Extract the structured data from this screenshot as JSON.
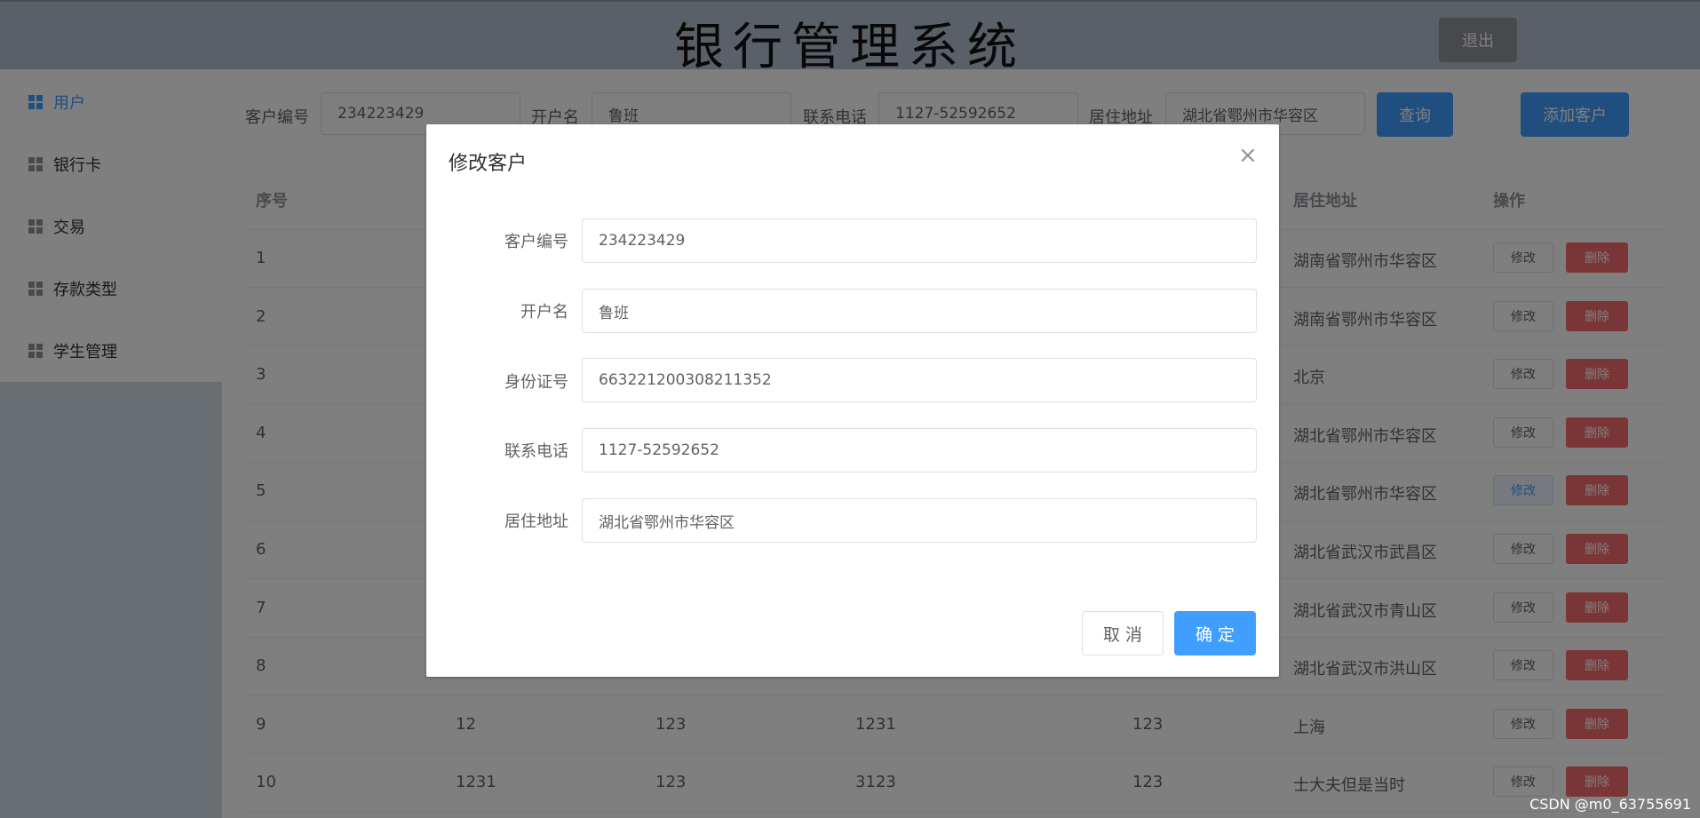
{
  "header": {
    "title": "银行管理系统",
    "logout_label": "退出"
  },
  "sidebar": {
    "items": [
      {
        "label": "用户"
      },
      {
        "label": "银行卡"
      },
      {
        "label": "交易"
      },
      {
        "label": "存款类型"
      },
      {
        "label": "学生管理"
      }
    ]
  },
  "search": {
    "customer_id_label": "客户编号",
    "customer_id_value": "234223429",
    "name_label": "开户名",
    "name_value": "鲁班",
    "phone_label": "联系电话",
    "phone_value": "1127-52592652",
    "address_label": "居住地址",
    "address_value": "湖北省鄂州市华容区",
    "query_label": "查询",
    "add_label": "添加客户"
  },
  "table": {
    "headers": {
      "index": "序号",
      "address": "居住地址",
      "actions": "操作"
    },
    "edit_label": "修改",
    "delete_label": "删除",
    "rows": [
      {
        "index": "1",
        "c2": "",
        "c3": "",
        "c4": "",
        "c5": "",
        "address": "湖南省鄂州市华容区"
      },
      {
        "index": "2",
        "c2": "",
        "c3": "",
        "c4": "",
        "c5": "",
        "address": "湖南省鄂州市华容区"
      },
      {
        "index": "3",
        "c2": "",
        "c3": "",
        "c4": "",
        "c5": "",
        "address": "北京"
      },
      {
        "index": "4",
        "c2": "",
        "c3": "",
        "c4": "",
        "c5": "",
        "address": "湖北省鄂州市华容区"
      },
      {
        "index": "5",
        "c2": "",
        "c3": "",
        "c4": "",
        "c5": "",
        "address": "湖北省鄂州市华容区"
      },
      {
        "index": "6",
        "c2": "",
        "c3": "",
        "c4": "",
        "c5": "",
        "address": "湖北省武汉市武昌区"
      },
      {
        "index": "7",
        "c2": "",
        "c3": "",
        "c4": "",
        "c5": "",
        "address": "湖北省武汉市青山区"
      },
      {
        "index": "8",
        "c2": "",
        "c3": "",
        "c4": "",
        "c5": "",
        "address": "湖北省武汉市洪山区"
      },
      {
        "index": "9",
        "c2": "12",
        "c3": "123",
        "c4": "1231",
        "c5": "123",
        "address": "上海"
      },
      {
        "index": "10",
        "c2": "1231",
        "c3": "123",
        "c4": "3123",
        "c5": "123",
        "address": "士大夫但是当时"
      }
    ]
  },
  "dialog": {
    "title": "修改客户",
    "close_icon": "close-icon",
    "fields": [
      {
        "label": "客户编号",
        "value": "234223429"
      },
      {
        "label": "开户名",
        "value": "鲁班"
      },
      {
        "label": "身份证号",
        "value": "663221200308211352"
      },
      {
        "label": "联系电话",
        "value": "1127-52592652"
      },
      {
        "label": "居住地址",
        "value": "湖北省鄂州市华容区"
      }
    ],
    "cancel_label": "取 消",
    "ok_label": "确 定"
  },
  "watermark": "CSDN @m0_63755691",
  "colors": {
    "primary": "#409eff",
    "danger": "#f56c6c",
    "header_bg": "#b3c0d1"
  }
}
